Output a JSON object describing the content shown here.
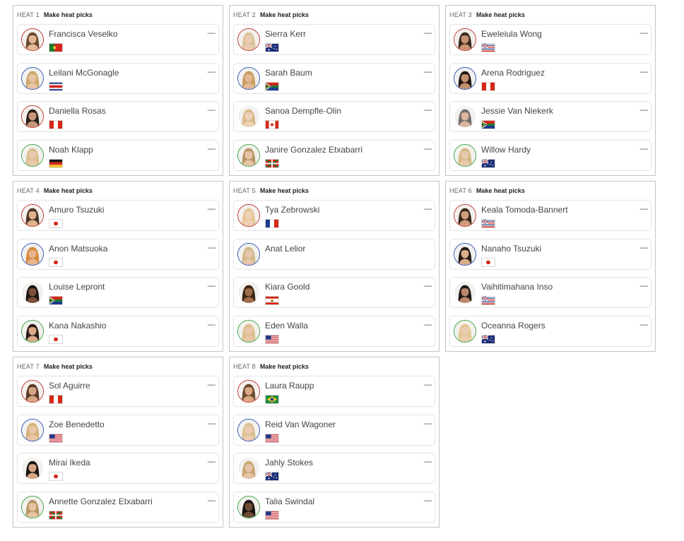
{
  "heats": [
    {
      "label": "HEAT 1",
      "action": "Make heat picks",
      "surfers": [
        {
          "name": "Francisca Veselko",
          "flag": "portugal-flag",
          "ring": "#c0392b",
          "hair": "#6b4a2e",
          "skin": "#e2b898",
          "score": "––"
        },
        {
          "name": "Leilani McGonagle",
          "flag": "costa-rica-flag",
          "ring": "#2e55b8",
          "hair": "#cba86b",
          "skin": "#e8c3a4",
          "score": "––"
        },
        {
          "name": "Daniella Rosas",
          "flag": "peru-flag",
          "ring": "#c0392b",
          "hair": "#2c2019",
          "skin": "#c89778",
          "score": "––"
        },
        {
          "name": "Noah Klapp",
          "flag": "germany-flag",
          "ring": "#3aa345",
          "hair": "#d8c08e",
          "skin": "#e9c8ad",
          "score": "––"
        }
      ]
    },
    {
      "label": "HEAT 2",
      "action": "Make heat picks",
      "surfers": [
        {
          "name": "Sierra Kerr",
          "flag": "australia-flag",
          "ring": "#c0392b",
          "hair": "#d9c59a",
          "skin": "#ebcab0",
          "score": "––"
        },
        {
          "name": "Sarah Baum",
          "flag": "south-africa-flag",
          "ring": "#2e55b8",
          "hair": "#c79e62",
          "skin": "#e3b793",
          "score": "––"
        },
        {
          "name": "Sanoa Dempfle-Olin",
          "flag": "canada-flag",
          "ring": "#ffffff",
          "hair": "#d7b98a",
          "skin": "#edd1b8",
          "score": "––"
        },
        {
          "name": "Janire Gonzalez Etxabarri",
          "flag": "basque-flag",
          "ring": "#3aa345",
          "hair": "#b99667",
          "skin": "#e8c4a6",
          "score": "––"
        }
      ]
    },
    {
      "label": "HEAT 3",
      "action": "Make heat picks",
      "surfers": [
        {
          "name": "Eweleiula Wong",
          "flag": "hawaii-flag",
          "ring": "#c0392b",
          "hair": "#3a2a1e",
          "skin": "#c99474",
          "score": "––"
        },
        {
          "name": "Arena Rodriguez",
          "flag": "peru-flag",
          "ring": "#2e55b8",
          "hair": "#211915",
          "skin": "#c4906f",
          "score": "––"
        },
        {
          "name": "Jessie Van Niekerk",
          "flag": "south-africa-flag",
          "ring": "#ffffff",
          "hair": "#6f6f6f",
          "skin": "#dcb69d",
          "score": "––"
        },
        {
          "name": "Willow Hardy",
          "flag": "australia-flag",
          "ring": "#3aa345",
          "hair": "#d3b985",
          "skin": "#e9c9ae",
          "score": "––"
        }
      ]
    },
    {
      "label": "HEAT 4",
      "action": "Make heat picks",
      "surfers": [
        {
          "name": "Amuro Tsuzuki",
          "flag": "japan-flag",
          "ring": "#c0392b",
          "hair": "#4a3425",
          "skin": "#dfb08c",
          "score": "––"
        },
        {
          "name": "Anon Matsuoka",
          "flag": "japan-flag",
          "ring": "#2e55b8",
          "hair": "#d68a3a",
          "skin": "#e6b48d",
          "score": "––"
        },
        {
          "name": "Louise Lepront",
          "flag": "south-africa-flag",
          "ring": "#ffffff",
          "hair": "#1c1714",
          "skin": "#7a5138",
          "score": "––"
        },
        {
          "name": "Kana Nakashio",
          "flag": "japan-flag",
          "ring": "#3aa345",
          "hair": "#2a1d16",
          "skin": "#d9a988",
          "score": "––"
        }
      ]
    },
    {
      "label": "HEAT 5",
      "action": "Make heat picks",
      "surfers": [
        {
          "name": "Tya Zebrowski",
          "flag": "france-flag",
          "ring": "#c0392b",
          "hair": "#e7c796",
          "skin": "#efcfb6",
          "score": "––"
        },
        {
          "name": "Anat Lelior",
          "flag": "",
          "ring": "#2e55b8",
          "hair": "#d2b98c",
          "skin": "#e7c6ab",
          "score": ""
        },
        {
          "name": "Kiara Goold",
          "flag": "french-polynesia-flag",
          "ring": "#ffffff",
          "hair": "#3b2717",
          "skin": "#a06d4b",
          "score": "––"
        },
        {
          "name": "Eden Walla",
          "flag": "usa-flag",
          "ring": "#3aa345",
          "hair": "#d8be8c",
          "skin": "#e8c5a8",
          "score": "––"
        }
      ]
    },
    {
      "label": "HEAT 6",
      "action": "Make heat picks",
      "surfers": [
        {
          "name": "Keala Tomoda-Bannert",
          "flag": "hawaii-flag",
          "ring": "#c0392b",
          "hair": "#3a281c",
          "skin": "#cf9d7c",
          "score": "––"
        },
        {
          "name": "Nanaho Tsuzuki",
          "flag": "japan-flag",
          "ring": "#2e55b8",
          "hair": "#241a14",
          "skin": "#dcad8c",
          "score": "––"
        },
        {
          "name": "Vaihitimahana Inso",
          "flag": "hawaii-flag",
          "ring": "#ffffff",
          "hair": "#1f1a17",
          "skin": "#b9876a",
          "score": "––"
        },
        {
          "name": "Oceanna Rogers",
          "flag": "australia-flag",
          "ring": "#3aa345",
          "hair": "#e1c893",
          "skin": "#ecccb1",
          "score": "––"
        }
      ]
    },
    {
      "label": "HEAT 7",
      "action": "Make heat picks",
      "surfers": [
        {
          "name": "Sol Aguirre",
          "flag": "peru-flag",
          "ring": "#c0392b",
          "hair": "#5a3b27",
          "skin": "#d6a585",
          "score": "––"
        },
        {
          "name": "Zoe Benedetto",
          "flag": "usa-flag",
          "ring": "#2e55b8",
          "hair": "#d4b27a",
          "skin": "#e9c6a9",
          "score": "––"
        },
        {
          "name": "Mirai Ikeda",
          "flag": "japan-flag",
          "ring": "#ffffff",
          "hair": "#1e1714",
          "skin": "#d4a685",
          "score": "––"
        },
        {
          "name": "Annette Gonzalez Etxabarri",
          "flag": "basque-flag",
          "ring": "#3aa345",
          "hair": "#b89667",
          "skin": "#e7c3a5",
          "score": "––"
        }
      ]
    },
    {
      "label": "HEAT 8",
      "action": "Make heat picks",
      "surfers": [
        {
          "name": "Laura Raupp",
          "flag": "brazil-flag",
          "ring": "#c0392b",
          "hair": "#6b4a2c",
          "skin": "#d9a884",
          "score": "––"
        },
        {
          "name": "Reid Van Wagoner",
          "flag": "usa-flag",
          "ring": "#2e55b8",
          "hair": "#d9c092",
          "skin": "#ebcab0",
          "score": "––"
        },
        {
          "name": "Jahly Stokes",
          "flag": "australia-flag",
          "ring": "#ffffff",
          "hair": "#c7a774",
          "skin": "#e6c3a7",
          "score": "––"
        },
        {
          "name": "Talia Swindal",
          "flag": "usa-flag",
          "ring": "#3aa345",
          "hair": "#1a1412",
          "skin": "#6e4b36",
          "score": "––"
        }
      ]
    }
  ]
}
